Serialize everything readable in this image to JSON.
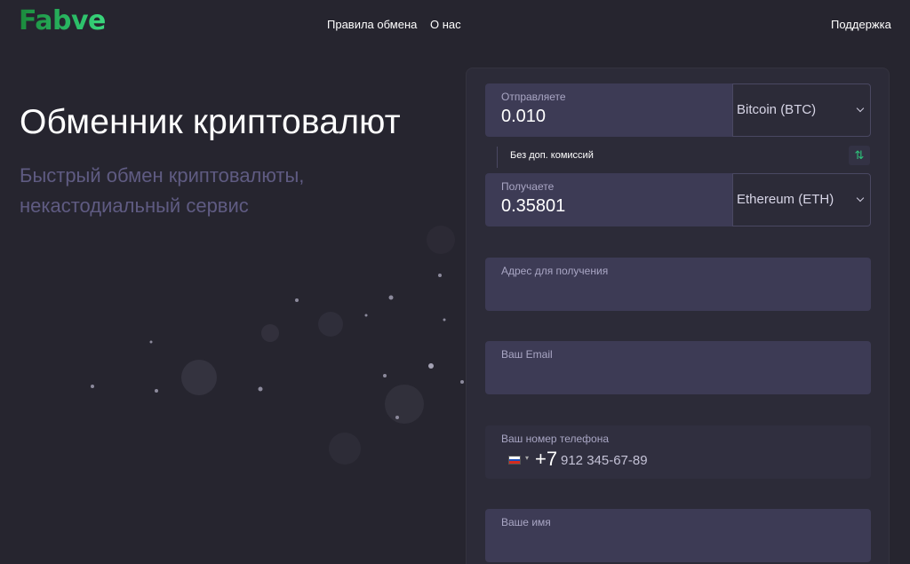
{
  "header": {
    "logo": "Fabve",
    "nav": {
      "rules": "Правила обмена",
      "about": "О нас"
    },
    "support": "Поддержка"
  },
  "hero": {
    "title": "Обменник криптовалют",
    "subtitle": "Быстрый обмен криптовалюты, некастодиальный сервис"
  },
  "exchange": {
    "send": {
      "label": "Отправляете",
      "amount": "0.010",
      "currency": "Bitcoin (BTC)"
    },
    "fee_note": "Без доп. комиссий",
    "swap_icon": "⇅",
    "receive": {
      "label": "Получаете",
      "amount": "0.35801",
      "currency": "Ethereum (ETH)"
    },
    "address": {
      "label": "Адрес для получения"
    },
    "email": {
      "label": "Ваш Email"
    },
    "phone": {
      "label": "Ваш номер телефона",
      "prefix": "+7",
      "placeholder": "912 345-67-89"
    },
    "name": {
      "label": "Ваше имя"
    }
  },
  "colors": {
    "background": "#26252f",
    "panel": "#2c2b38",
    "field": "#3d3b55",
    "accent": "#2cc06a",
    "subtitle": "#5f5b82"
  }
}
